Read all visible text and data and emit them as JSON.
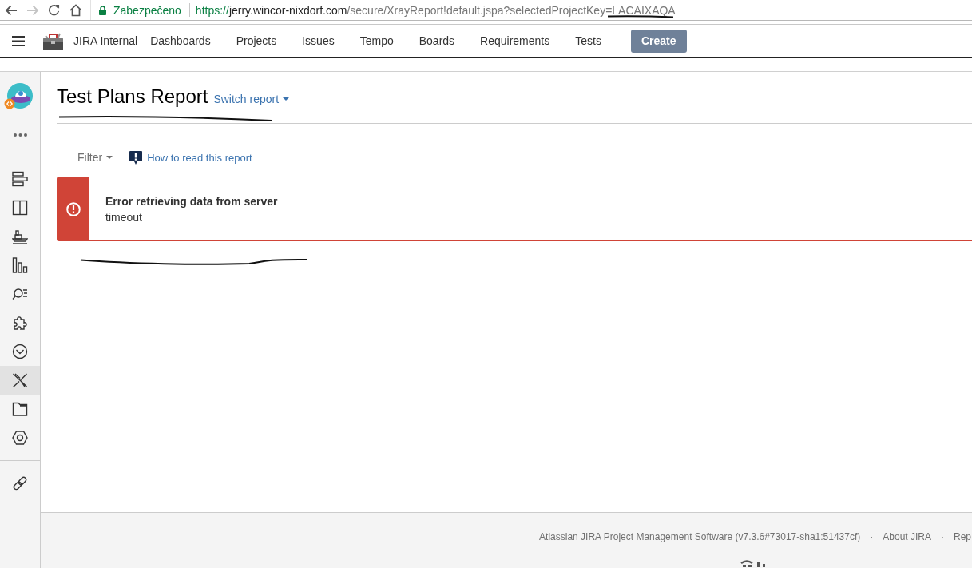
{
  "browser": {
    "buttons": [
      {
        "kind": "back",
        "disabled": false
      },
      {
        "kind": "forward",
        "disabled": true
      },
      {
        "kind": "reload",
        "disabled": false
      },
      {
        "kind": "home",
        "disabled": false
      }
    ],
    "address_bar": {
      "security_label": "Zabezpečeno",
      "url_scheme": "https://",
      "url_host": "jerry.wincor-nixdorf.com",
      "url_path": "/secure/XrayReport!default.jspa?selectedProjectKey=LACAIXAQA"
    }
  },
  "header": {
    "app_name": "JIRA Internal",
    "nav": [
      {
        "label": "Dashboards"
      },
      {
        "label": "Projects"
      },
      {
        "label": "Issues"
      },
      {
        "label": "Tempo"
      },
      {
        "label": "Boards"
      },
      {
        "label": "Requirements"
      },
      {
        "label": "Tests"
      }
    ],
    "create_button": "Create"
  },
  "sidebar": {
    "items": [
      {
        "kind": "backlog",
        "selected": false
      },
      {
        "kind": "board",
        "selected": false
      },
      {
        "kind": "ship",
        "selected": false
      },
      {
        "kind": "chart",
        "selected": false
      },
      {
        "kind": "search",
        "selected": false
      },
      {
        "kind": "puzzle",
        "selected": false
      },
      {
        "kind": "chevron",
        "selected": false
      },
      {
        "kind": "cross",
        "selected": true
      },
      {
        "kind": "folder",
        "selected": false
      },
      {
        "kind": "hexagon",
        "selected": false
      }
    ],
    "bottom_items": [
      {
        "kind": "link",
        "selected": false
      }
    ]
  },
  "report": {
    "title": "Test Plans Report",
    "switch_link": "Switch report",
    "filter": "Filter",
    "help_link": "How to read this report"
  },
  "error": {
    "title": "Error retrieving data from server",
    "message": "timeout"
  },
  "footer": {
    "items": [
      {
        "kind": "link",
        "text": "Atlassian JIRA Project Management Software (v7.3.6#73017-sha1:51437cf)"
      },
      {
        "kind": "separator",
        "text": "·"
      },
      {
        "kind": "link",
        "text": "About JIRA"
      },
      {
        "kind": "separator",
        "text": "·"
      },
      {
        "kind": "link",
        "text": "Rep"
      }
    ]
  }
}
